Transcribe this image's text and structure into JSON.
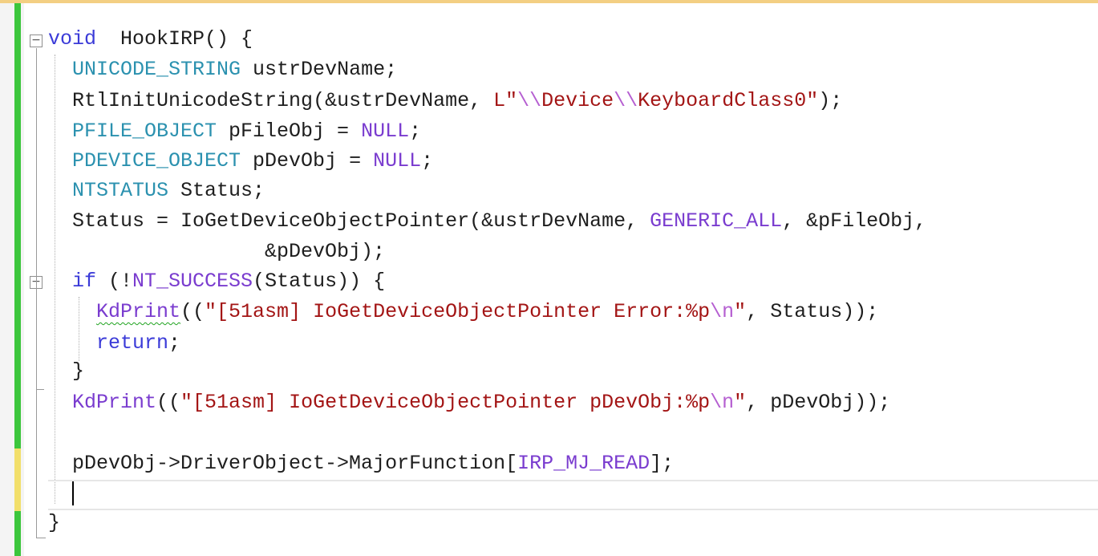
{
  "editor": {
    "lines": [
      {
        "id": "l1",
        "tokens": [
          [
            "kw",
            "void"
          ],
          [
            "",
            "  HookIRP() {"
          ]
        ]
      },
      {
        "id": "l2",
        "tokens": [
          [
            "ty",
            "UNICODE_STRING"
          ],
          [
            "",
            " ustrDevName;"
          ]
        ]
      },
      {
        "id": "l3",
        "tokens": [
          [
            "fn",
            "RtlInitUnicodeString"
          ],
          [
            "",
            "(&ustrDevName, "
          ],
          [
            "str",
            "L\""
          ],
          [
            "esc",
            "\\\\"
          ],
          [
            "str",
            "Device"
          ],
          [
            "esc",
            "\\\\"
          ],
          [
            "str",
            "KeyboardClass0\""
          ],
          [
            "",
            ");"
          ]
        ]
      },
      {
        "id": "l4",
        "tokens": [
          [
            "ty",
            "PFILE_OBJECT"
          ],
          [
            "",
            " pFileObj = "
          ],
          [
            "mac",
            "NULL"
          ],
          [
            "",
            ";"
          ]
        ]
      },
      {
        "id": "l5",
        "tokens": [
          [
            "ty",
            "PDEVICE_OBJECT"
          ],
          [
            "",
            " pDevObj = "
          ],
          [
            "mac",
            "NULL"
          ],
          [
            "",
            ";"
          ]
        ]
      },
      {
        "id": "l6",
        "tokens": [
          [
            "ty",
            "NTSTATUS"
          ],
          [
            "",
            " Status;"
          ]
        ]
      },
      {
        "id": "l7",
        "tokens": [
          [
            "",
            "Status = IoGetDeviceObjectPointer(&ustrDevName, "
          ],
          [
            "mac",
            "GENERIC_ALL"
          ],
          [
            "",
            ", &pFileObj,"
          ]
        ]
      },
      {
        "id": "l8",
        "tokens": [
          [
            "",
            "                &pDevObj);"
          ]
        ]
      },
      {
        "id": "l9",
        "tokens": [
          [
            "kw",
            "if"
          ],
          [
            "",
            " (!"
          ],
          [
            "mac",
            "NT_SUCCESS"
          ],
          [
            "",
            "(Status)) {"
          ]
        ]
      },
      {
        "id": "l10",
        "tokens": [
          [
            "mac squig",
            "KdPrint"
          ],
          [
            "",
            "(("
          ],
          [
            "str",
            "\"[51asm] IoGetDeviceObjectPointer Error:%p"
          ],
          [
            "esc",
            "\\n"
          ],
          [
            "str",
            "\""
          ],
          [
            "",
            ", Status));"
          ]
        ]
      },
      {
        "id": "l11",
        "tokens": [
          [
            "kw",
            "return"
          ],
          [
            "",
            ";"
          ]
        ]
      },
      {
        "id": "l12",
        "tokens": [
          [
            "",
            "}"
          ]
        ]
      },
      {
        "id": "l13",
        "tokens": [
          [
            "mac",
            "KdPrint"
          ],
          [
            "",
            "(("
          ],
          [
            "str",
            "\"[51asm] IoGetDeviceObjectPointer pDevObj:%p"
          ],
          [
            "esc",
            "\\n"
          ],
          [
            "str",
            "\""
          ],
          [
            "",
            ", pDevObj));"
          ]
        ]
      },
      {
        "id": "l14",
        "tokens": []
      },
      {
        "id": "l15",
        "tokens": [
          [
            "",
            "pDevObj->DriverObject->MajorFunction["
          ],
          [
            "mac",
            "IRP_MJ_READ"
          ],
          [
            "",
            "];"
          ]
        ]
      },
      {
        "id": "l16",
        "tokens": []
      },
      {
        "id": "l17",
        "tokens": [
          [
            "",
            "}"
          ]
        ]
      }
    ],
    "colors": {
      "accent_bar_green": "#3cc63c",
      "accent_bar_yellow": "#f2df6a",
      "top_border": "#f3cf83"
    },
    "fold_glyph": "−"
  }
}
